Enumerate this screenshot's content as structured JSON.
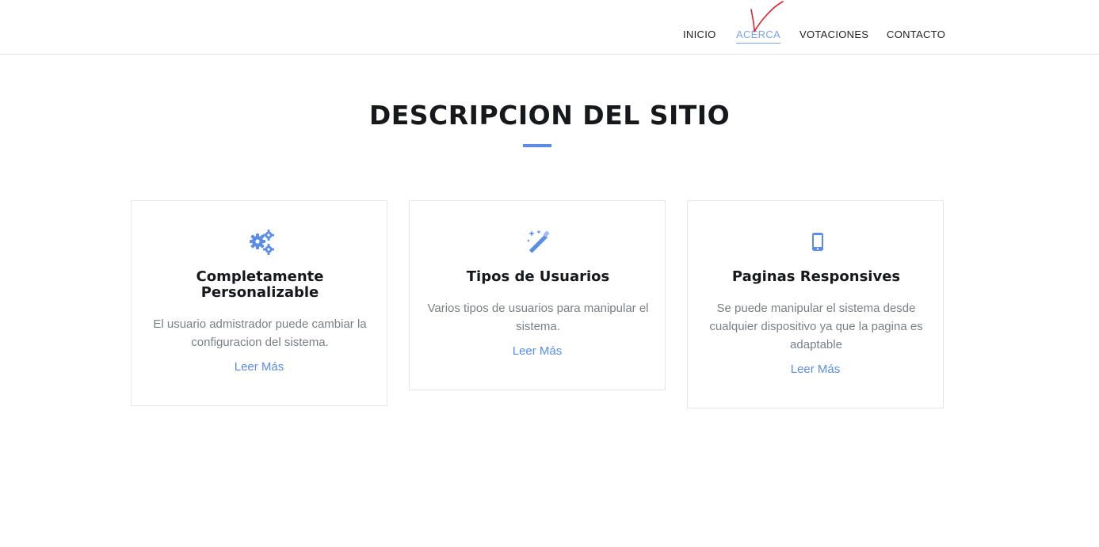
{
  "nav": {
    "items": [
      {
        "label": "INICIO",
        "active": false
      },
      {
        "label": "ACERCA",
        "active": true
      },
      {
        "label": "VOTACIONES",
        "active": false
      },
      {
        "label": "CONTACTO",
        "active": false
      }
    ]
  },
  "section": {
    "title": "DESCRIPCION DEL SITIO"
  },
  "cards": [
    {
      "icon": "gears-icon",
      "title": "Completamente Personalizable",
      "text": "El usuario admistrador puede cambiar la configuracion del sistema.",
      "link": "Leer Más"
    },
    {
      "icon": "magic-wand-icon",
      "title": "Tipos de Usuarios",
      "text": "Varios tipos de usuarios para manipular el sistema.",
      "link": "Leer Más"
    },
    {
      "icon": "mobile-phone-icon",
      "title": "Paginas Responsives",
      "text": "Se puede manipular el sistema desde cualquier dispositivo ya que la pagina es adaptable",
      "link": "Leer Más"
    }
  ],
  "colors": {
    "accent": "#5b8de8",
    "nav_active": "#7aa4ea",
    "annotation": "#e0202a"
  },
  "annotation": {
    "icon": "handwritten-checkmark"
  }
}
